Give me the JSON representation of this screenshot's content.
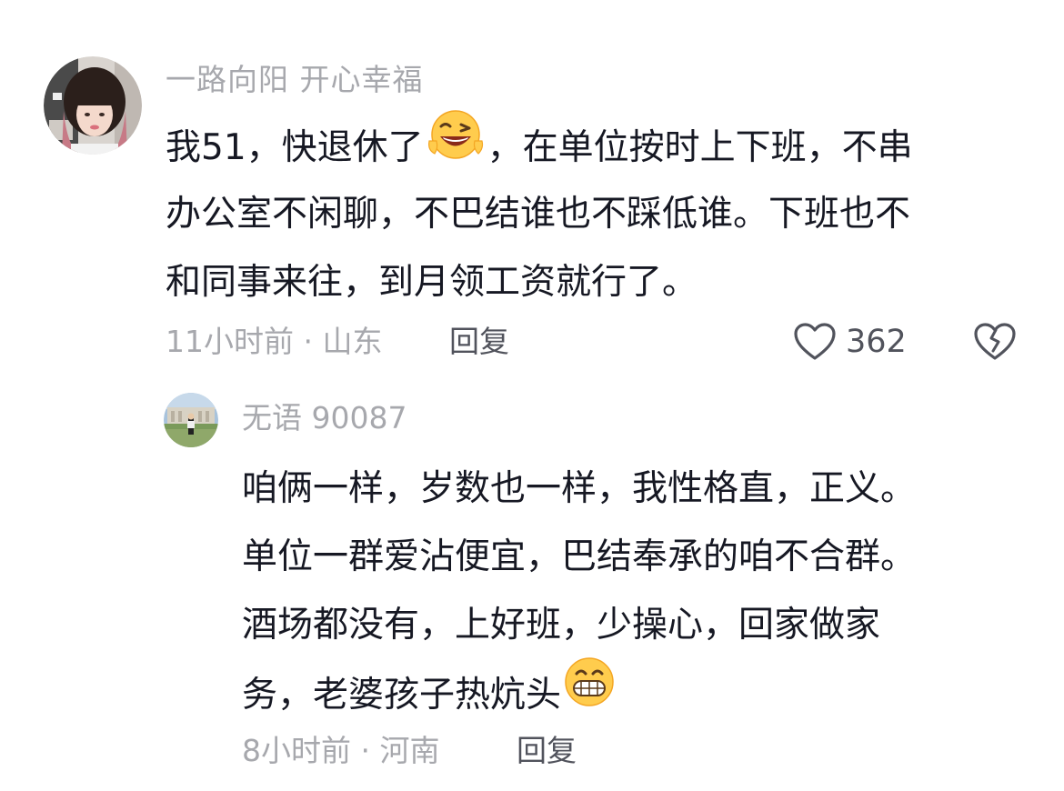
{
  "comment": {
    "author": "一路向阳 开心幸福",
    "lines": [
      {
        "before": "我51，快退休了",
        "emoji": "wink-grin-emoji",
        "after": "，在单位按时上下班，不串"
      },
      {
        "text": "办公室不闲聊，不巴结谁也不踩低谁。下班也不"
      },
      {
        "text": "和同事来往，到月领工资就行了。"
      }
    ],
    "meta": "11小时前 · 山东",
    "reply_label": "回复",
    "like_count": "362",
    "like_icon": "heart-outline-icon",
    "dislike_icon": "broken-heart-icon"
  },
  "reply": {
    "author": "无语 90087",
    "lines": [
      {
        "text": "咱俩一样，岁数也一样，我性格直，正义。"
      },
      {
        "text": "单位一群爱沾便宜，巴结奉承的咱不合群。"
      },
      {
        "text": "酒场都没有，上好班，少操心，回家做家"
      },
      {
        "before": "务，老婆孩子热炕头",
        "emoji": "grin-teeth-emoji",
        "after": ""
      }
    ],
    "meta": "8小时前 · 河南",
    "reply_label": "回复"
  },
  "colors": {
    "text_primary": "#161823",
    "text_secondary": "#a7a8ad",
    "action": "#51535c"
  }
}
